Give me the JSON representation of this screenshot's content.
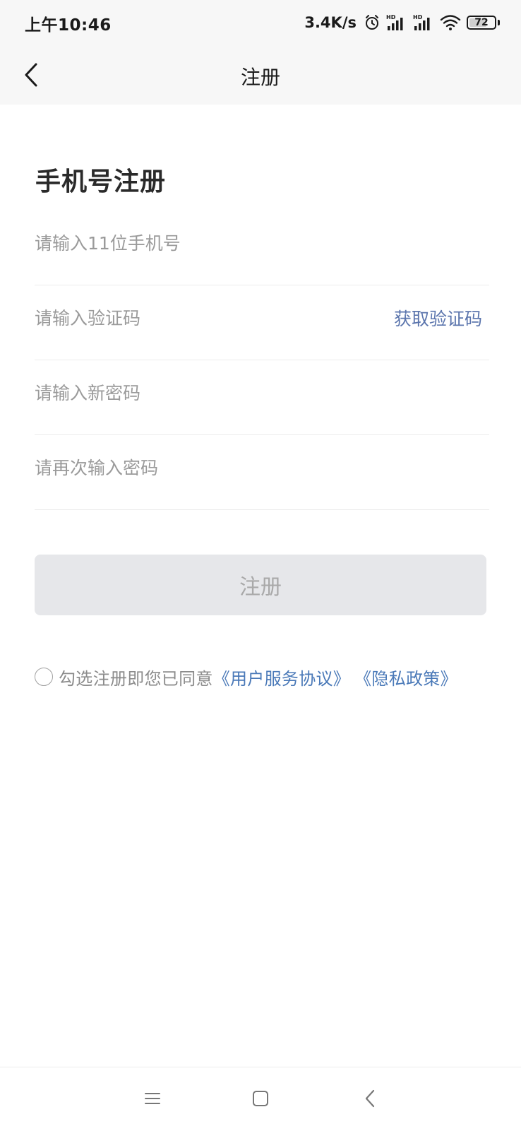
{
  "status_bar": {
    "time": "上午10:46",
    "net_speed": "3.4K/s",
    "icons": [
      "alarm-icon",
      "hd-signal-icon",
      "hd-signal-icon",
      "wifi-icon",
      "battery-icon"
    ],
    "signal_badge": "HD",
    "battery_level": 72,
    "battery_text": "72"
  },
  "nav": {
    "back_icon": "chevron-left-icon",
    "title": "注册"
  },
  "form": {
    "heading": "手机号注册",
    "phone_placeholder": "请输入11位手机号",
    "code_placeholder": "请输入验证码",
    "get_code_label": "获取验证码",
    "password_placeholder": "请输入新密码",
    "confirm_password_placeholder": "请再次输入密码",
    "submit_label": "注册"
  },
  "agreement": {
    "checked": false,
    "prefix": "勾选注册即您已同意",
    "user_agreement": "《用户服务协议》",
    "privacy_policy": "《隐私政策》"
  },
  "system_nav": {
    "icons": [
      "menu-icon",
      "home-icon",
      "back-icon"
    ]
  },
  "colors": {
    "bar_background": "#f7f7f7",
    "link_blue": "#4a79b8",
    "code_link": "#5b75ad",
    "disabled_button": "#e6e7ea",
    "placeholder": "#9a9a9a"
  }
}
